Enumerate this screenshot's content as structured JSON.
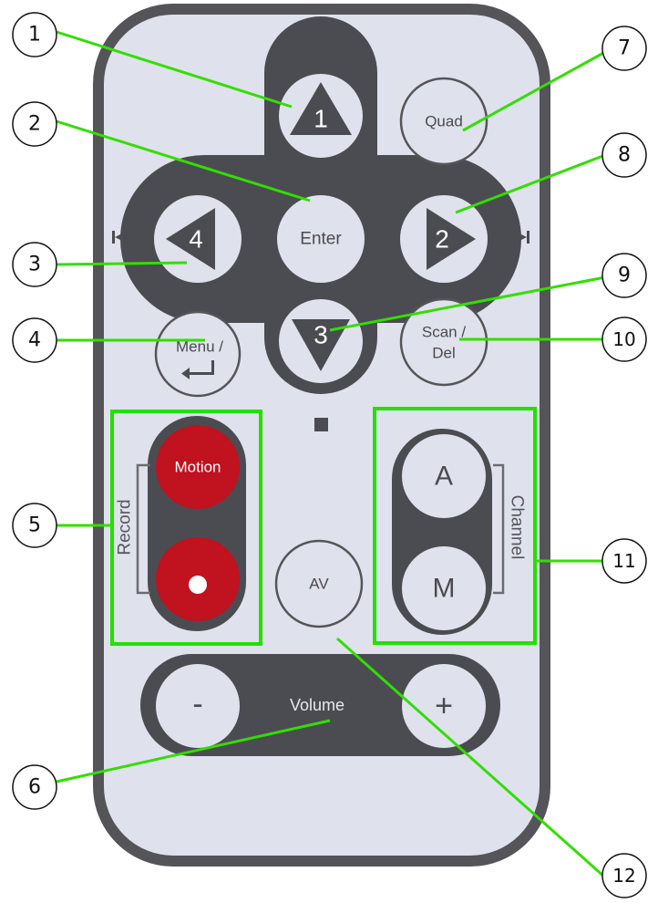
{
  "colors": {
    "remote_body": "#dfe2ec",
    "remote_border": "#545459",
    "dark_panel": "#4b4c51",
    "button_fill": "#dfe2ec",
    "button_text": "#4a4b50",
    "record_red": "#c0121f",
    "highlight_green": "#22e000",
    "callout_line": "#33dd00"
  },
  "icons": {
    "play_pause": "play-pause-icon",
    "stop": "stop-icon",
    "previous": "skip-previous-icon",
    "next": "skip-next-icon",
    "enter_return": "return-arrow-icon"
  },
  "buttons": {
    "up": {
      "number": "1"
    },
    "enter": {
      "label": "Enter"
    },
    "left": {
      "number": "4"
    },
    "right": {
      "number": "2"
    },
    "down": {
      "number": "3"
    },
    "quad": {
      "label": "Quad"
    },
    "menu": {
      "label": "Menu /"
    },
    "scan": {
      "line1": "Scan /",
      "line2": "Del"
    },
    "motion": {
      "label": "Motion"
    },
    "record_dot": {
      "label": ""
    },
    "channel_a": {
      "label": "A"
    },
    "channel_m": {
      "label": "M"
    },
    "av": {
      "label": "AV"
    },
    "volume_minus": {
      "label": "-"
    },
    "volume_plus": {
      "label": "+"
    }
  },
  "labels": {
    "record": "Record",
    "channel": "Channel",
    "volume": "Volume"
  },
  "callouts": [
    "1",
    "2",
    "3",
    "4",
    "5",
    "6",
    "7",
    "8",
    "9",
    "10",
    "11",
    "12"
  ]
}
